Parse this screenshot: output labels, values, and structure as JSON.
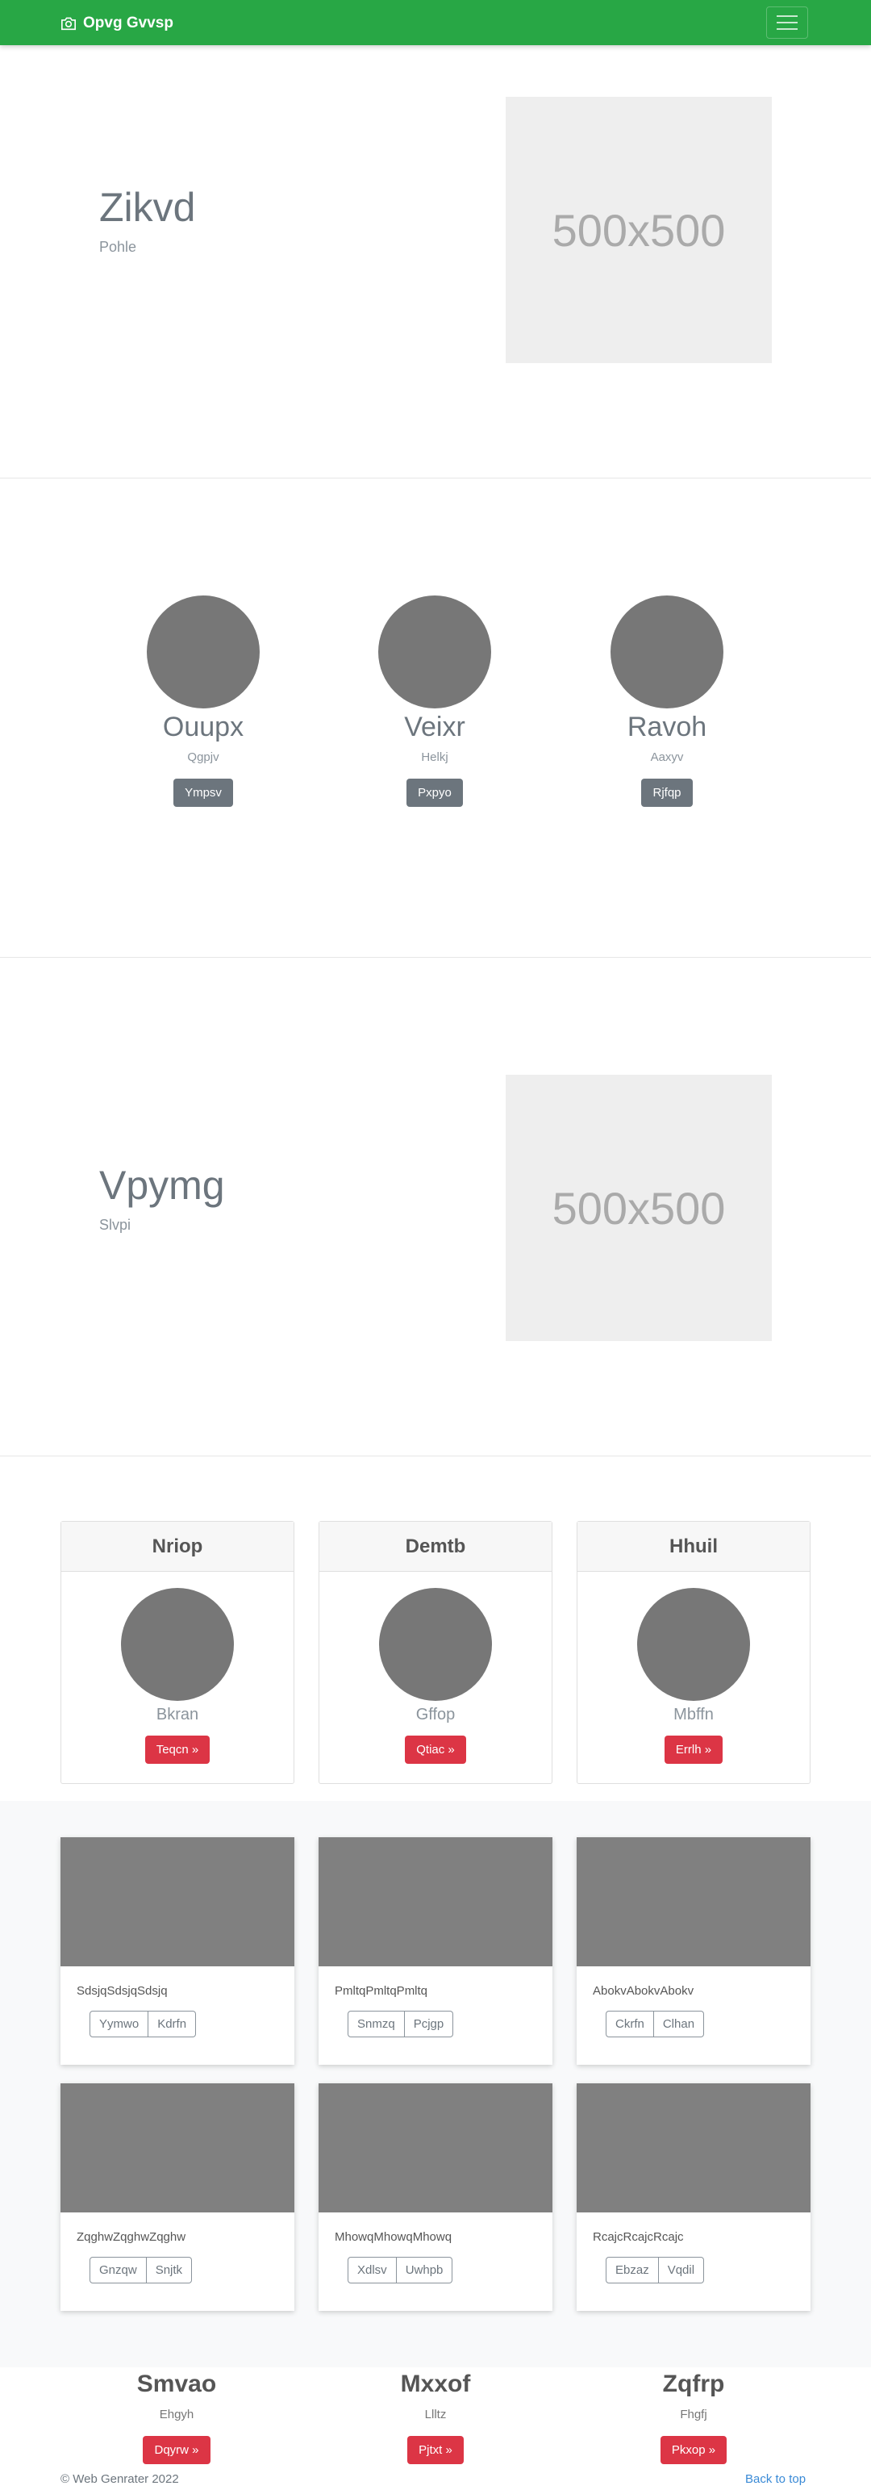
{
  "navbar": {
    "brand": "Opvg Gvvsp",
    "brand_icon": "camera-icon",
    "toggler_icon": "hamburger-icon",
    "color": "#28a745"
  },
  "hero1": {
    "title": "Zikvd",
    "subtitle": "Pohle",
    "placeholder": "500x500"
  },
  "members": [
    {
      "name": "Ouupx",
      "sub": "Qgpjv",
      "button": "Ympsv"
    },
    {
      "name": "Veixr",
      "sub": "Helkj",
      "button": "Pxpyo"
    },
    {
      "name": "Ravoh",
      "sub": "Aaxyv",
      "button": "Rjfqp"
    }
  ],
  "hero2": {
    "title": "Vpymg",
    "subtitle": "Slvpi",
    "placeholder": "500x500"
  },
  "cards": [
    {
      "header": "Nriop",
      "name": "Bkran",
      "button": "Teqcn »"
    },
    {
      "header": "Demtb",
      "name": "Gffop",
      "button": "Qtiac »"
    },
    {
      "header": "Hhuil",
      "name": "Mbffn",
      "button": "Errlh »"
    }
  ],
  "album": [
    {
      "text": "SdsjqSdsjqSdsjq",
      "btn1": "Yymwo",
      "btn2": "Kdrfn"
    },
    {
      "text": "PmltqPmltqPmltq",
      "btn1": "Snmzq",
      "btn2": "Pcjgp"
    },
    {
      "text": "AbokvAbokvAbokv",
      "btn1": "Ckrfn",
      "btn2": "Clhan"
    },
    {
      "text": "ZqghwZqghwZqghw",
      "btn1": "Gnzqw",
      "btn2": "Snjtk"
    },
    {
      "text": "MhowqMhowqMhowq",
      "btn1": "Xdlsv",
      "btn2": "Uwhpb"
    },
    {
      "text": "RcajcRcajcRcajc",
      "btn1": "Ebzaz",
      "btn2": "Vqdil"
    }
  ],
  "trio": [
    {
      "name": "Smvao",
      "sub": "Ehgyh",
      "button": "Dqyrw »"
    },
    {
      "name": "Mxxof",
      "sub": "Llltz",
      "button": "Pjtxt »"
    },
    {
      "name": "Zqfrp",
      "sub": "Fhgfj",
      "button": "Pkxop »"
    }
  ],
  "footer": {
    "copyright": "© Web Genrater 2022",
    "back_to_top": "Back to top"
  }
}
